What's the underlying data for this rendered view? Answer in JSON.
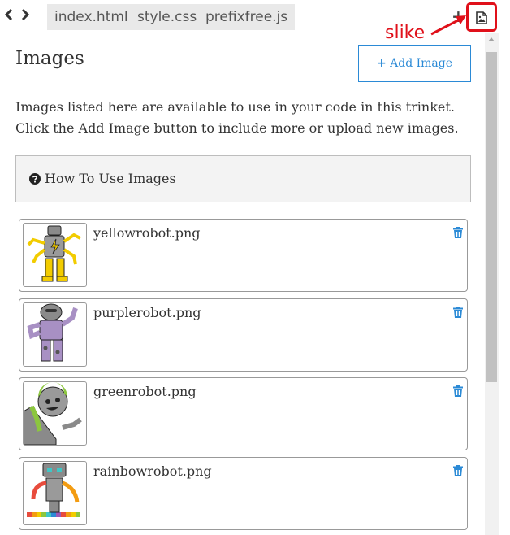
{
  "tabs": [
    "index.html",
    "style.css",
    "prefixfree.js"
  ],
  "icons": {
    "back": "chevron-left-icon",
    "forward": "chevron-right-icon",
    "add_tab": "plus-icon",
    "images_tab": "image-file-icon",
    "howto": "question-circle-icon",
    "delete": "trash-icon"
  },
  "add_tab_label": "+",
  "annotation": {
    "text": "slike",
    "color": "#e0101a"
  },
  "page": {
    "title": "Images",
    "add_button_label": "Add Image",
    "intro": "Images listed here are available to use in your code in this trinket. Click the Add Image button to include more or upload new images.",
    "howto_label": "How To Use Images"
  },
  "images": [
    {
      "name": "yellowrobot.png"
    },
    {
      "name": "purplerobot.png"
    },
    {
      "name": "greenrobot.png"
    },
    {
      "name": "rainbowrobot.png"
    }
  ],
  "colors": {
    "accent": "#2b8ad6",
    "annotation": "#e0101a"
  }
}
